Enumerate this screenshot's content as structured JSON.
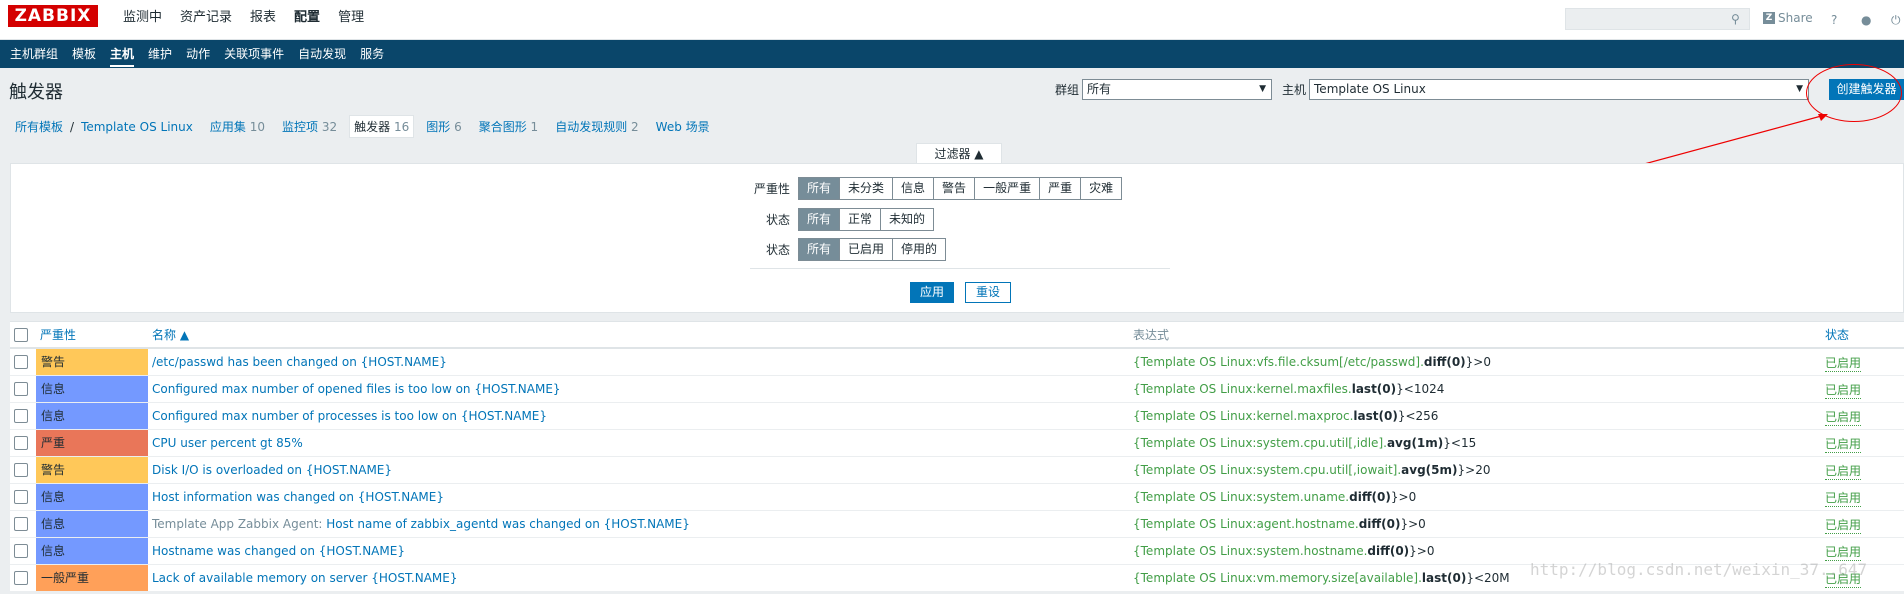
{
  "brand": "ZABBIX",
  "main_nav": [
    "监测中",
    "资产记录",
    "报表",
    "配置",
    "管理"
  ],
  "main_nav_active": "配置",
  "top_right": {
    "share": "Share",
    "help": "?"
  },
  "sub_nav": [
    "主机群组",
    "模板",
    "主机",
    "维护",
    "动作",
    "关联项事件",
    "自动发现",
    "服务"
  ],
  "sub_nav_active": "主机",
  "page_title": "触发器",
  "header": {
    "group_label": "群组",
    "group_value": "所有",
    "host_label": "主机",
    "host_value": "Template OS Linux",
    "create_button": "创建触发器"
  },
  "host_tabs": {
    "all_templates": "所有模板",
    "template": "Template OS Linux",
    "tabs": [
      {
        "label": "应用集",
        "count": "10"
      },
      {
        "label": "监控项",
        "count": "32"
      },
      {
        "label": "触发器",
        "count": "16"
      },
      {
        "label": "图形",
        "count": "6"
      },
      {
        "label": "聚合图形",
        "count": "1"
      },
      {
        "label": "自动发现规则",
        "count": "2"
      },
      {
        "label": "Web 场景",
        "count": ""
      }
    ]
  },
  "filter": {
    "tab_label": "过滤器 ▲",
    "severity_label": "严重性",
    "severity_options": [
      "所有",
      "未分类",
      "信息",
      "警告",
      "一般严重",
      "严重",
      "灾难"
    ],
    "state_label": "状态",
    "state_options": [
      "所有",
      "正常",
      "未知的"
    ],
    "status_label": "状态",
    "status_options": [
      "所有",
      "已启用",
      "停用的"
    ],
    "apply": "应用",
    "reset": "重设"
  },
  "table": {
    "headers": {
      "severity": "严重性",
      "name": "名称 ▲",
      "expression": "表达式",
      "status": "状态"
    },
    "rows": [
      {
        "severity": "警告",
        "sev_color": "#ffc859",
        "prefix": "",
        "name": "/etc/passwd has been changed on {HOST.NAME}",
        "expr_open": "{",
        "expr_key": "Template OS Linux:vfs.file.cksum[/etc/passwd].",
        "expr_fn": "diff(0)",
        "expr_close": "}>0",
        "status": "已启用"
      },
      {
        "severity": "信息",
        "sev_color": "#7499ff",
        "prefix": "",
        "name": "Configured max number of opened files is too low on {HOST.NAME}",
        "expr_open": "{",
        "expr_key": "Template OS Linux:kernel.maxfiles.",
        "expr_fn": "last(0)",
        "expr_close": "}<1024",
        "status": "已启用"
      },
      {
        "severity": "信息",
        "sev_color": "#7499ff",
        "prefix": "",
        "name": "Configured max number of processes is too low on {HOST.NAME}",
        "expr_open": "{",
        "expr_key": "Template OS Linux:kernel.maxproc.",
        "expr_fn": "last(0)",
        "expr_close": "}<256",
        "status": "已启用"
      },
      {
        "severity": "严重",
        "sev_color": "#e97659",
        "prefix": "",
        "name": "CPU user percent gt 85%",
        "expr_open": "{",
        "expr_key": "Template OS Linux:system.cpu.util[,idle].",
        "expr_fn": "avg(1m)",
        "expr_close": "}<15",
        "status": "已启用"
      },
      {
        "severity": "警告",
        "sev_color": "#ffc859",
        "prefix": "",
        "name": "Disk I/O is overloaded on {HOST.NAME}",
        "expr_open": "{",
        "expr_key": "Template OS Linux:system.cpu.util[,iowait].",
        "expr_fn": "avg(5m)",
        "expr_close": "}>20",
        "status": "已启用"
      },
      {
        "severity": "信息",
        "sev_color": "#7499ff",
        "prefix": "",
        "name": "Host information was changed on {HOST.NAME}",
        "expr_open": "{",
        "expr_key": "Template OS Linux:system.uname.",
        "expr_fn": "diff(0)",
        "expr_close": "}>0",
        "status": "已启用"
      },
      {
        "severity": "信息",
        "sev_color": "#7499ff",
        "prefix": "Template App Zabbix Agent:",
        "name": "Host name of zabbix_agentd was changed on {HOST.NAME}",
        "expr_open": "{",
        "expr_key": "Template OS Linux:agent.hostname.",
        "expr_fn": "diff(0)",
        "expr_close": "}>0",
        "status": "已启用"
      },
      {
        "severity": "信息",
        "sev_color": "#7499ff",
        "prefix": "",
        "name": "Hostname was changed on {HOST.NAME}",
        "expr_open": "{",
        "expr_key": "Template OS Linux:system.hostname.",
        "expr_fn": "diff(0)",
        "expr_close": "}>0",
        "status": "已启用"
      },
      {
        "severity": "一般严重",
        "sev_color": "#ffa059",
        "prefix": "",
        "name": "Lack of available memory on server {HOST.NAME}",
        "expr_open": "{",
        "expr_key": "Template OS Linux:vm.memory.size[available].",
        "expr_fn": "last(0)",
        "expr_close": "}<20M",
        "status": "已启用"
      }
    ]
  },
  "watermark": "http://blog.csdn.net/weixin_37..647"
}
